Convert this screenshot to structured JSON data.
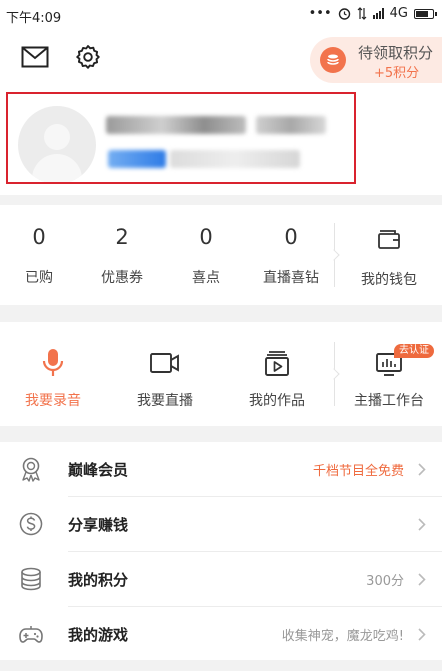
{
  "status_bar": {
    "time": "下午4:09",
    "network": "4G"
  },
  "header": {
    "mail_icon": "mail-icon",
    "settings_icon": "gear-icon",
    "points_pill": {
      "label": "待领取积分",
      "bonus": "+5积分",
      "icon": "coin-stack-icon"
    }
  },
  "stats": [
    {
      "value": "0",
      "label": "已购"
    },
    {
      "value": "2",
      "label": "优惠券"
    },
    {
      "value": "0",
      "label": "喜点"
    },
    {
      "value": "0",
      "label": "直播喜钻"
    }
  ],
  "wallet": {
    "label": "我的钱包",
    "icon": "wallet-icon"
  },
  "features": [
    {
      "label": "我要录音",
      "icon": "microphone-icon",
      "active": true
    },
    {
      "label": "我要直播",
      "icon": "video-camera-icon"
    },
    {
      "label": "我的作品",
      "icon": "play-works-icon"
    },
    {
      "label": "主播工作台",
      "icon": "studio-icon",
      "badge": "去认证"
    }
  ],
  "menu": [
    {
      "title": "巅峰会员",
      "meta": "千档节目全免费",
      "icon": "vip-medal-icon"
    },
    {
      "title": "分享赚钱",
      "meta": "",
      "icon": "dollar-coin-icon"
    },
    {
      "title": "我的积分",
      "meta": "300分",
      "icon": "points-stack-icon"
    },
    {
      "title": "我的游戏",
      "meta": "收集神宠，魔龙吃鸡!",
      "icon": "gamepad-icon"
    }
  ],
  "colors": {
    "accent": "#f2734c",
    "highlight_box": "#d9232e",
    "pill_background": "#fdeae3"
  }
}
